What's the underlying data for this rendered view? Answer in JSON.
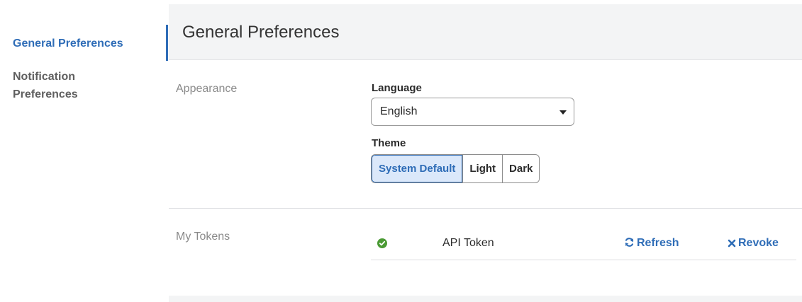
{
  "sidebar": {
    "items": [
      {
        "label": "General Preferences",
        "active": true
      },
      {
        "label": "Notification Preferences",
        "active": false
      }
    ]
  },
  "header": {
    "title": "General Preferences"
  },
  "appearance": {
    "section_label": "Appearance",
    "language": {
      "label": "Language",
      "value": "English"
    },
    "theme": {
      "label": "Theme",
      "options": [
        "System Default",
        "Light",
        "Dark"
      ],
      "selected": "System Default"
    }
  },
  "tokens": {
    "section_label": "My Tokens",
    "rows": [
      {
        "status_icon": "check-circle-icon",
        "name": "API Token",
        "refresh_label": "Refresh",
        "revoke_label": "Revoke"
      }
    ]
  },
  "colors": {
    "accent": "#2f6db7",
    "success": "#4a9a34",
    "selected_bg": "#dbe8fa"
  }
}
